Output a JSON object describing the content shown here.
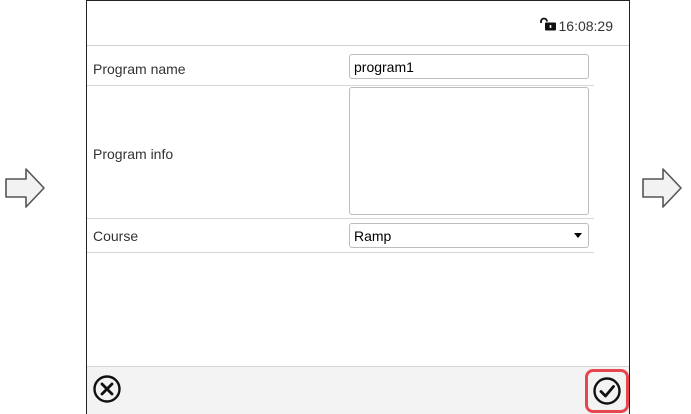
{
  "header": {
    "time": "16:08:29",
    "lock_icon": "unlocked-padlock-icon"
  },
  "form": {
    "program_name": {
      "label": "Program name",
      "value": "program1"
    },
    "program_info": {
      "label": "Program info",
      "value": ""
    },
    "course": {
      "label": "Course",
      "value": "Ramp"
    }
  },
  "footer": {
    "cancel_icon": "circle-x-icon",
    "confirm_icon": "circle-check-icon",
    "confirm_highlight_color": "#e8464e"
  },
  "side_arrows": {
    "icon": "outline-right-arrow-icon"
  }
}
